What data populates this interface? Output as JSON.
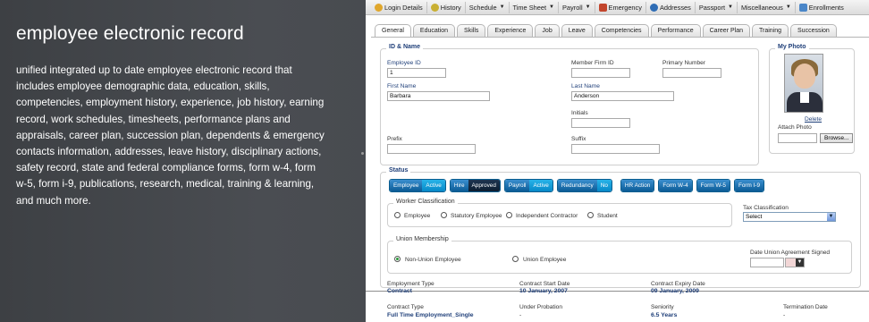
{
  "left": {
    "title": "employee electronic record",
    "description": "unified integrated up to date  employee electronic record that includes employee demographic data, education, skills, competencies,   employment history, experience, job history, earning record, work schedules, timesheets, performance plans and appraisals, career plan,  succession plan, dependents & emergency contacts information, addresses, leave history, disciplinary actions, safety record, state and federal compliance forms, form w-4, form w-5, form i-9, publications, research, medical, training & learning, and much more."
  },
  "toolbar": [
    {
      "label": "Login Details",
      "icon": "user-icon",
      "color": "#e0a72c"
    },
    {
      "label": "History",
      "icon": "history-icon",
      "color": "#c9b033"
    },
    {
      "label": "Schedule",
      "dropdown": true
    },
    {
      "label": "Time Sheet",
      "dropdown": true
    },
    {
      "label": "Payroll",
      "dropdown": true
    },
    {
      "label": "Emergency",
      "icon": "emergency-icon",
      "color": "#c2452c"
    },
    {
      "label": "Addresses",
      "icon": "globe-icon",
      "color": "#2f6db5"
    },
    {
      "label": "Passport",
      "dropdown": true
    },
    {
      "label": "Miscellaneous",
      "dropdown": true
    },
    {
      "label": "Enrollments",
      "icon": "window-icon",
      "color": "#4a86c8"
    }
  ],
  "tabs": [
    "General",
    "Education",
    "Skills",
    "Experience",
    "Job",
    "Leave",
    "Competencies",
    "Performance",
    "Career Plan",
    "Training",
    "Succession"
  ],
  "id_name": {
    "legend": "ID & Name",
    "employee_id_label": "Employee ID",
    "employee_id": "1",
    "member_firm_label": "Member Firm ID",
    "primary_number_label": "Primary Number",
    "first_name_label": "First Name",
    "first_name": "Barbara",
    "last_name_label": "Last Name",
    "last_name": "Anderson",
    "initials_label": "Initials",
    "prefix_label": "Prefix",
    "suffix_label": "Suffix"
  },
  "photo": {
    "legend": "My Photo",
    "delete_label": "Delete",
    "attach_label": "Attach Photo",
    "browse_label": "Browse..."
  },
  "status": {
    "legend": "Status",
    "buttons": [
      {
        "left": "Employee",
        "right": "Active"
      },
      {
        "left": "Hire",
        "right": "Approved",
        "dark": true
      },
      {
        "left": "Payroll",
        "right": "Active"
      },
      {
        "left": "Redundancy",
        "right": "No"
      },
      {
        "left": "HR Action"
      },
      {
        "left": "Form W-4"
      },
      {
        "left": "Form W-5"
      },
      {
        "left": "Form I-9"
      }
    ],
    "worker_classification_label": "Worker Classification",
    "worker_options": [
      "Employee",
      "Statutory Employee",
      "Independent Contractor",
      "Student"
    ],
    "tax_classification_label": "Tax Classification",
    "tax_classification_value": "Select",
    "union_label": "Union Membership",
    "union_options": [
      "Non-Union Employee",
      "Union Employee"
    ],
    "union_selected": "Non-Union Employee",
    "date_union_label": "Date Union Agreement Signed"
  },
  "details": {
    "employment_type_label": "Employment Type",
    "employment_type": "Contract",
    "contract_start_label": "Contract Start Date",
    "contract_start": "10 January, 2007",
    "contract_expiry_label": "Contract Expiry Date",
    "contract_expiry": "09 January, 2009",
    "contract_type_label": "Contract Type",
    "contract_type": "Full Time Employment_Single",
    "under_probation_label": "Under Probation",
    "under_probation": "-",
    "seniority_label": "Seniority",
    "seniority": "6.5 Years",
    "termination_label": "Termination Date",
    "termination": "-"
  }
}
